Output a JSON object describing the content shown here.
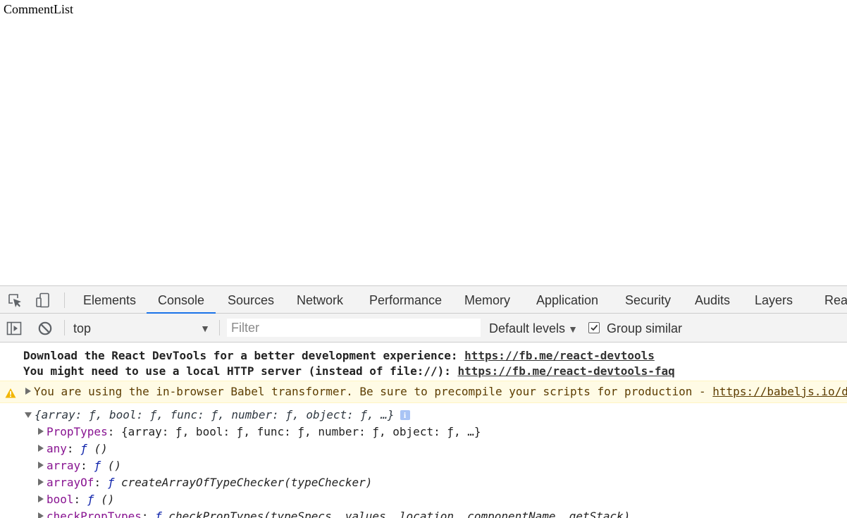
{
  "page": {
    "heading": "CommentList"
  },
  "devtools": {
    "tabs": [
      {
        "label": "Elements"
      },
      {
        "label": "Console"
      },
      {
        "label": "Sources"
      },
      {
        "label": "Network"
      },
      {
        "label": "Performance"
      },
      {
        "label": "Memory"
      },
      {
        "label": "Application"
      },
      {
        "label": "Security"
      },
      {
        "label": "Audits"
      },
      {
        "label": "Layers"
      },
      {
        "label": "Reac"
      }
    ],
    "active_tab": "Console",
    "accent_color": "#1a73e8",
    "toolbar_icons": [
      "inspect-element-icon",
      "device-toolbar-icon"
    ],
    "console_toolbar": {
      "icons": [
        "sidebar-toggle-icon",
        "clear-console-icon"
      ],
      "context": "top",
      "filter_placeholder": "Filter",
      "levels_label": "Default levels",
      "group_similar_label": "Group similar",
      "group_similar_checked": true
    },
    "messages": {
      "line1_text": "Download the React DevTools for a better development experience: ",
      "line1_link": "https://fb.me/react-devtools",
      "line2_text": "You might need to use a local HTTP server (instead of file://): ",
      "line2_link": "https://fb.me/react-devtools-faq",
      "warning_text": "You are using the in-browser Babel transformer. Be sure to precompile your scripts for production - ",
      "warning_link": "https://babeljs.io/docs/setup/",
      "object_summary": "{array: ƒ, bool: ƒ, func: ƒ, number: ƒ, object: ƒ, …}",
      "info_badge": "i",
      "properties": [
        {
          "name": "PropTypes",
          "func": "",
          "value": "{array: ƒ, bool: ƒ, func: ƒ, number: ƒ, object: ƒ, …}"
        },
        {
          "name": "any",
          "func": "ƒ",
          "value": "()"
        },
        {
          "name": "array",
          "func": "ƒ",
          "value": "()"
        },
        {
          "name": "arrayOf",
          "func": "ƒ",
          "value": "createArrayOfTypeChecker(typeChecker)"
        },
        {
          "name": "bool",
          "func": "ƒ",
          "value": "()"
        },
        {
          "name": "checkPropTypes",
          "func": "ƒ",
          "value": "checkPropTypes(typeSpecs, values, location, componentName, getStack)"
        }
      ]
    }
  }
}
